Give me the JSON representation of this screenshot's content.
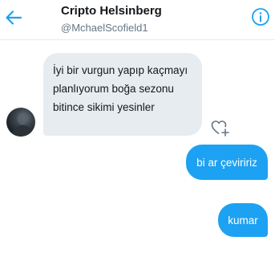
{
  "header": {
    "back_icon": "arrow-left-icon",
    "title": "Cripto Helsinberg",
    "handle": "@MchaelScofield1",
    "info_icon": "info-circle-icon"
  },
  "messages": [
    {
      "direction": "incoming",
      "text": "İyi bir vurgun yapıp kaçmayı planlıyorum boğa sezonu bitince sikimi yesinler"
    },
    {
      "direction": "outgoing",
      "text": "bi ar çeviririz"
    },
    {
      "direction": "outgoing",
      "text": "kumar"
    }
  ],
  "icons": {
    "like": "heart-plus-icon",
    "avatar": "avatar-image"
  },
  "colors": {
    "accent": "#1da1f2",
    "incoming_bubble": "#e6ecf0",
    "text": "#14171a",
    "muted": "#657786"
  }
}
